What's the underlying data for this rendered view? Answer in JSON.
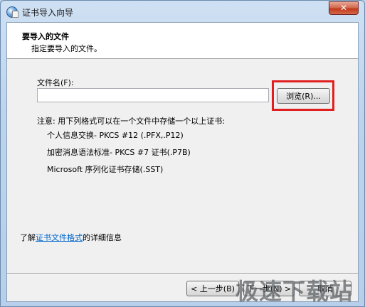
{
  "window": {
    "title": "证书导入向导",
    "close_label": "✕"
  },
  "header": {
    "title": "要导入的文件",
    "subtitle": "指定要导入的文件。"
  },
  "file_field": {
    "label": "文件名(F):",
    "value": "",
    "placeholder": ""
  },
  "browse_button": {
    "label": "浏览(R)..."
  },
  "note": {
    "text": "注意: 用下列格式可以在一个文件中存储一个以上证书:"
  },
  "formats": [
    "个人信息交换- PKCS #12 (.PFX,.P12)",
    "加密消息语法标准- PKCS #7 证书(.P7B)",
    "Microsoft 序列化证书存储(.SST)"
  ],
  "more_info": {
    "prefix": "了解",
    "link": "证书文件格式",
    "suffix": "的详细信息"
  },
  "buttons": {
    "back": "< 上一步(B)",
    "next": "下一步(N) >",
    "cancel": "取消"
  },
  "watermark": "极速下载站",
  "colors": {
    "highlight": "#e02020",
    "link": "#0066cc",
    "titlebar": "#bcd3ec",
    "close_button": "#c2391c"
  }
}
